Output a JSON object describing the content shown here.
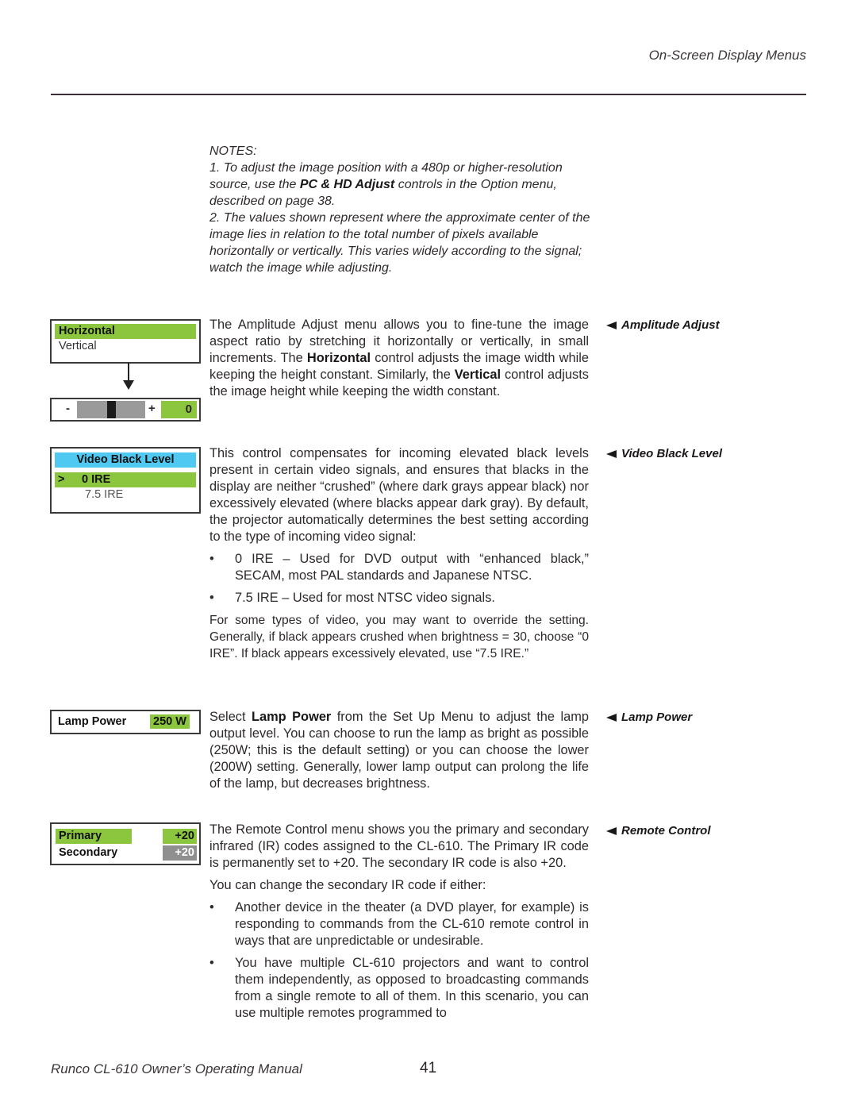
{
  "header": {
    "section_title": "On-Screen Display Menus"
  },
  "notes": {
    "heading": "NOTES:",
    "note1_pre": "1. To adjust the image position with a 480p or higher-resolution source, use the ",
    "note1_bold": "PC & HD Adjust",
    "note1_post": " controls in the Option menu, described on page 38.",
    "note2": "2. The values shown represent where the approximate center of the image lies in relation to the total number of pixels available horizontally or vertically. This varies widely according to the signal; watch the image while adjusting."
  },
  "amplitude": {
    "side_label": "Amplitude Adjust",
    "menu_items": [
      "Horizontal",
      "Vertical"
    ],
    "slider_minus": "-",
    "slider_plus": "+",
    "slider_value": "0",
    "slider_position": 0.5,
    "text_pre": "The Amplitude Adjust menu allows you to fine-tune the image aspect ratio by stretching it horizontally or vertically, in small increments. The ",
    "text_bold1": "Horizontal",
    "text_mid": " control adjusts the image width while keeping the height constant. Similarly, the ",
    "text_bold2": "Vertical",
    "text_post": " control adjusts the image height while keeping the width constant."
  },
  "video_black": {
    "side_label": "Video Black Level",
    "menu_title": "Video Black Level",
    "selected_marker": ">",
    "options": [
      "0 IRE",
      "7.5 IRE"
    ],
    "para1": "This control compensates for incoming elevated black levels present in certain video signals, and ensures that blacks in the display are neither “crushed” (where dark grays appear black) nor excessively elevated (where blacks appear dark gray). By default, the projector automatically determines the best setting according to the type of incoming video signal:",
    "bullets": [
      "0 IRE – Used for DVD output with “enhanced black,” SECAM, most PAL standards and Japanese NTSC.",
      "7.5 IRE – Used for most NTSC video signals."
    ],
    "para2": "For some types of video, you may want to override the setting. Generally, if black appears crushed when brightness = 30, choose “0 IRE”. If black appears excessively elevated, use “7.5 IRE.”"
  },
  "lamp_power": {
    "side_label": "Lamp Power",
    "menu_label": "Lamp Power",
    "menu_value": "250 W",
    "text_pre": "Select ",
    "text_bold": "Lamp Power",
    "text_post": " from the Set Up Menu to adjust the lamp output level. You can choose to run the lamp as bright as possible (250W; this is the default setting) or you can choose the lower (200W) setting. Generally, lower lamp output can prolong the life of the lamp, but decreases brightness."
  },
  "remote_control": {
    "side_label": "Remote Control",
    "rows": [
      {
        "label": "Primary",
        "value": "+20"
      },
      {
        "label": "Secondary",
        "value": "+20"
      }
    ],
    "para1": "The Remote Control menu shows you the primary and secondary infrared (IR) codes assigned to the CL-610. The Primary IR code is permanently set to +20. The secondary IR code is also +20.",
    "para2": "You can change the secondary IR code if either:",
    "bullets": [
      "Another device in the theater (a DVD player, for example) is responding to commands from the CL-610 remote control in ways that are unpredictable or undesirable.",
      "You have multiple CL-610 projectors and want to control them independently, as opposed to broadcasting commands from a single remote to all of them. In this scenario, you can use multiple remotes programmed to"
    ]
  },
  "footer": {
    "manual_title": "Runco CL-610 Owner’s Operating Manual",
    "page_number": "41"
  },
  "colors": {
    "highlight_green": "#8cc63f",
    "highlight_blue": "#4fc8f2",
    "value_gray": "#8f8f8f"
  }
}
